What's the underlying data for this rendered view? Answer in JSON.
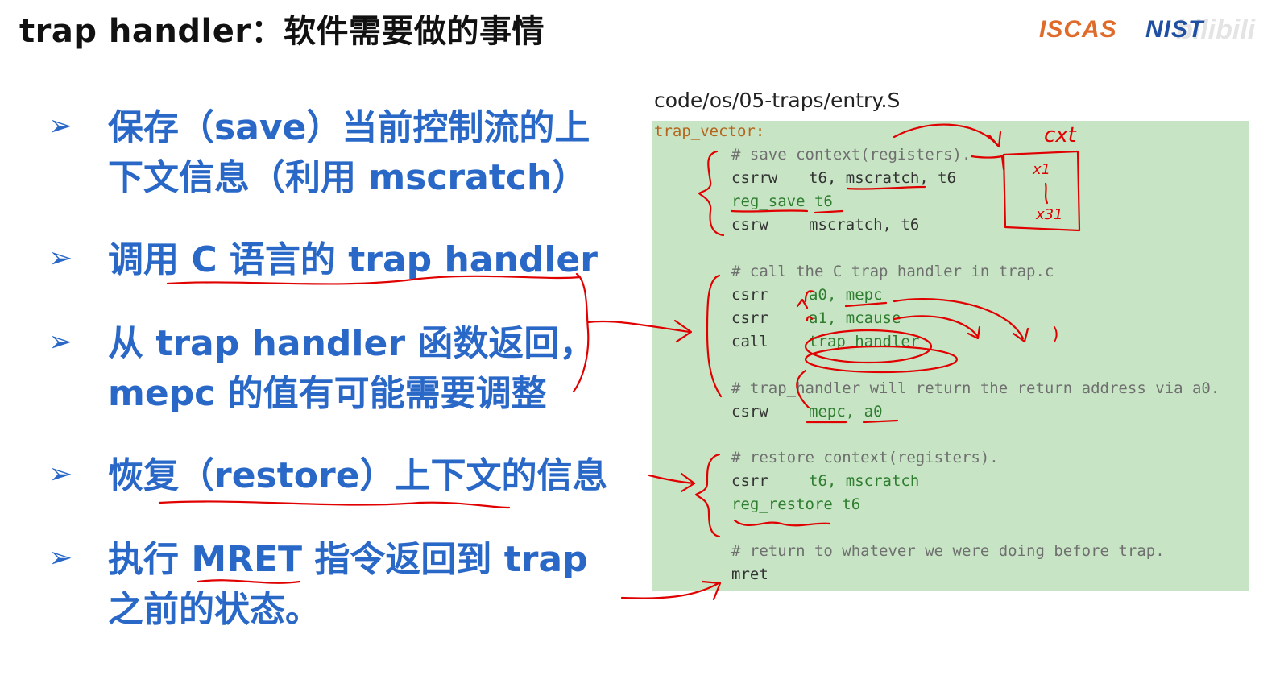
{
  "title": "trap handler：软件需要做的事情",
  "logos": {
    "iscas": "ISCAS",
    "nist": "NIST",
    "watermark": "bilibili"
  },
  "bullets": [
    {
      "lines": [
        "保存（save）当前控制流的上",
        "下文信息（利用 mscratch）"
      ]
    },
    {
      "lines": [
        "调用 C 语言的 trap handler"
      ]
    },
    {
      "lines": [
        "从 trap handler 函数返回，",
        "mepc 的值有可能需要调整"
      ]
    },
    {
      "lines": [
        "恢复（restore）上下文的信息"
      ]
    },
    {
      "lines": [
        "执行 MRET 指令返回到 trap",
        "之前的状态。"
      ]
    }
  ],
  "code": {
    "caption": "code/os/05-traps/entry.S",
    "label": "trap_vector:",
    "lines": [
      {
        "kind": "comment",
        "text": "# save context(registers)."
      },
      {
        "kind": "instr",
        "op": "csrrw",
        "args": "t6, mscratch, t6"
      },
      {
        "kind": "macro",
        "text": "reg_save t6"
      },
      {
        "kind": "instr",
        "op": "csrw",
        "args": "mscratch, t6"
      },
      {
        "kind": "comment",
        "text": "# call the C trap handler in trap.c"
      },
      {
        "kind": "instr",
        "op": "csrr",
        "args": "a0, mepc"
      },
      {
        "kind": "instr",
        "op": "csrr",
        "args": "a1, mcause"
      },
      {
        "kind": "instr",
        "op": "call",
        "args": "trap_handler"
      },
      {
        "kind": "comment",
        "text": "# trap_handler will return the return address via a0."
      },
      {
        "kind": "instr",
        "op": "csrw",
        "args": "mepc, a0"
      },
      {
        "kind": "comment",
        "text": "# restore context(registers)."
      },
      {
        "kind": "instr",
        "op": "csrr",
        "args": "t6, mscratch"
      },
      {
        "kind": "macro",
        "text": "reg_restore t6"
      },
      {
        "kind": "comment",
        "text": "# return to whatever we were doing before trap."
      },
      {
        "kind": "instr",
        "op": "mret",
        "args": ""
      }
    ]
  },
  "annotations": {
    "ctx": "cxt",
    "x1": "x1",
    "x31": "x31",
    "paren": ")"
  }
}
